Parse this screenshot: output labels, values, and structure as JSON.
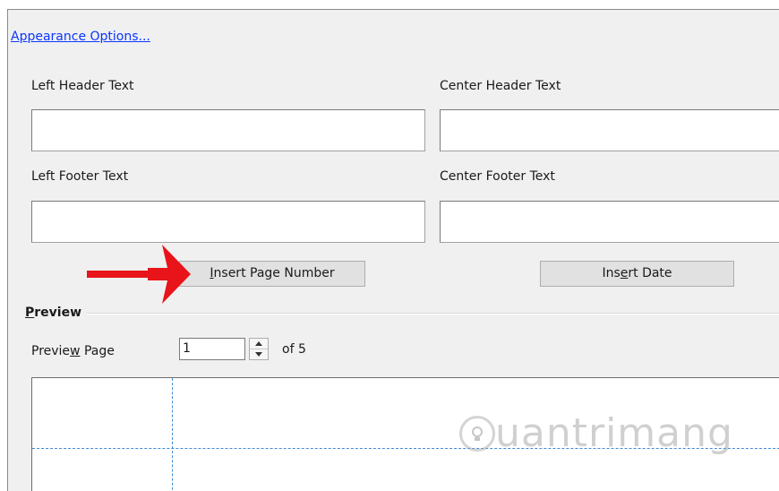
{
  "dialog": {
    "appearance_link": "Appearance Options...",
    "left_header_label": "Left Header Text",
    "center_header_label": "Center Header Text",
    "left_header_value": "",
    "center_header_value": "",
    "left_footer_label": "Left Footer Text",
    "center_footer_label": "Center Footer Text",
    "left_footer_value": "",
    "center_footer_value": "",
    "insert_page_number_button": {
      "before": "",
      "mnemonic": "I",
      "after": "nsert Page Number"
    },
    "insert_date_button": {
      "before": "Ins",
      "mnemonic": "e",
      "after": "rt Date"
    }
  },
  "preview": {
    "section_title": {
      "mnemonic": "P",
      "after": "review"
    },
    "page_label": {
      "before": "Previe",
      "mnemonic": "w",
      "after": " Page"
    },
    "page_value": "1",
    "page_total": "of 5"
  },
  "watermark": {
    "text": "uantrimang"
  },
  "colors": {
    "dialog_bg": "#f0f0f0",
    "link": "#0b36ff",
    "arrow": "#e8141a",
    "guide_line": "#3f8ad6"
  }
}
